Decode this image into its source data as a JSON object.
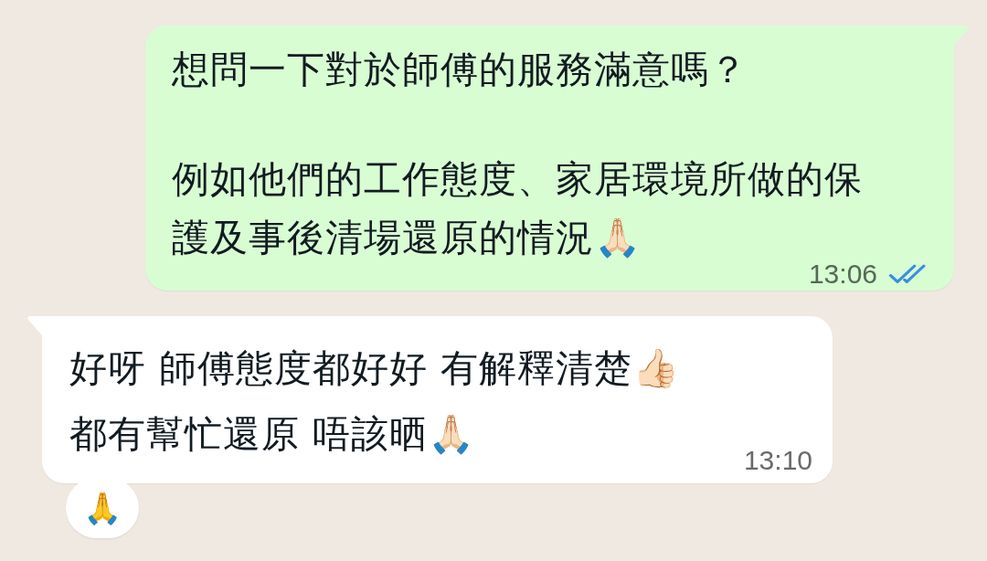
{
  "messages": [
    {
      "kind": "outgoing",
      "paragraphs": [
        "想問一下對於師傅的服務滿意嗎？",
        "例如他們的工作態度、家居環境所做的保護及事後清場還原的情況🙏🏻"
      ],
      "time": "13:06",
      "read": true
    },
    {
      "kind": "incoming",
      "paragraphs": [
        "好呀 師傅態度都好好 有解釋清楚👍🏻",
        "都有幫忙還原 唔該晒🙏🏻"
      ],
      "time": "13:10",
      "reactions": [
        "🙏"
      ]
    }
  ]
}
